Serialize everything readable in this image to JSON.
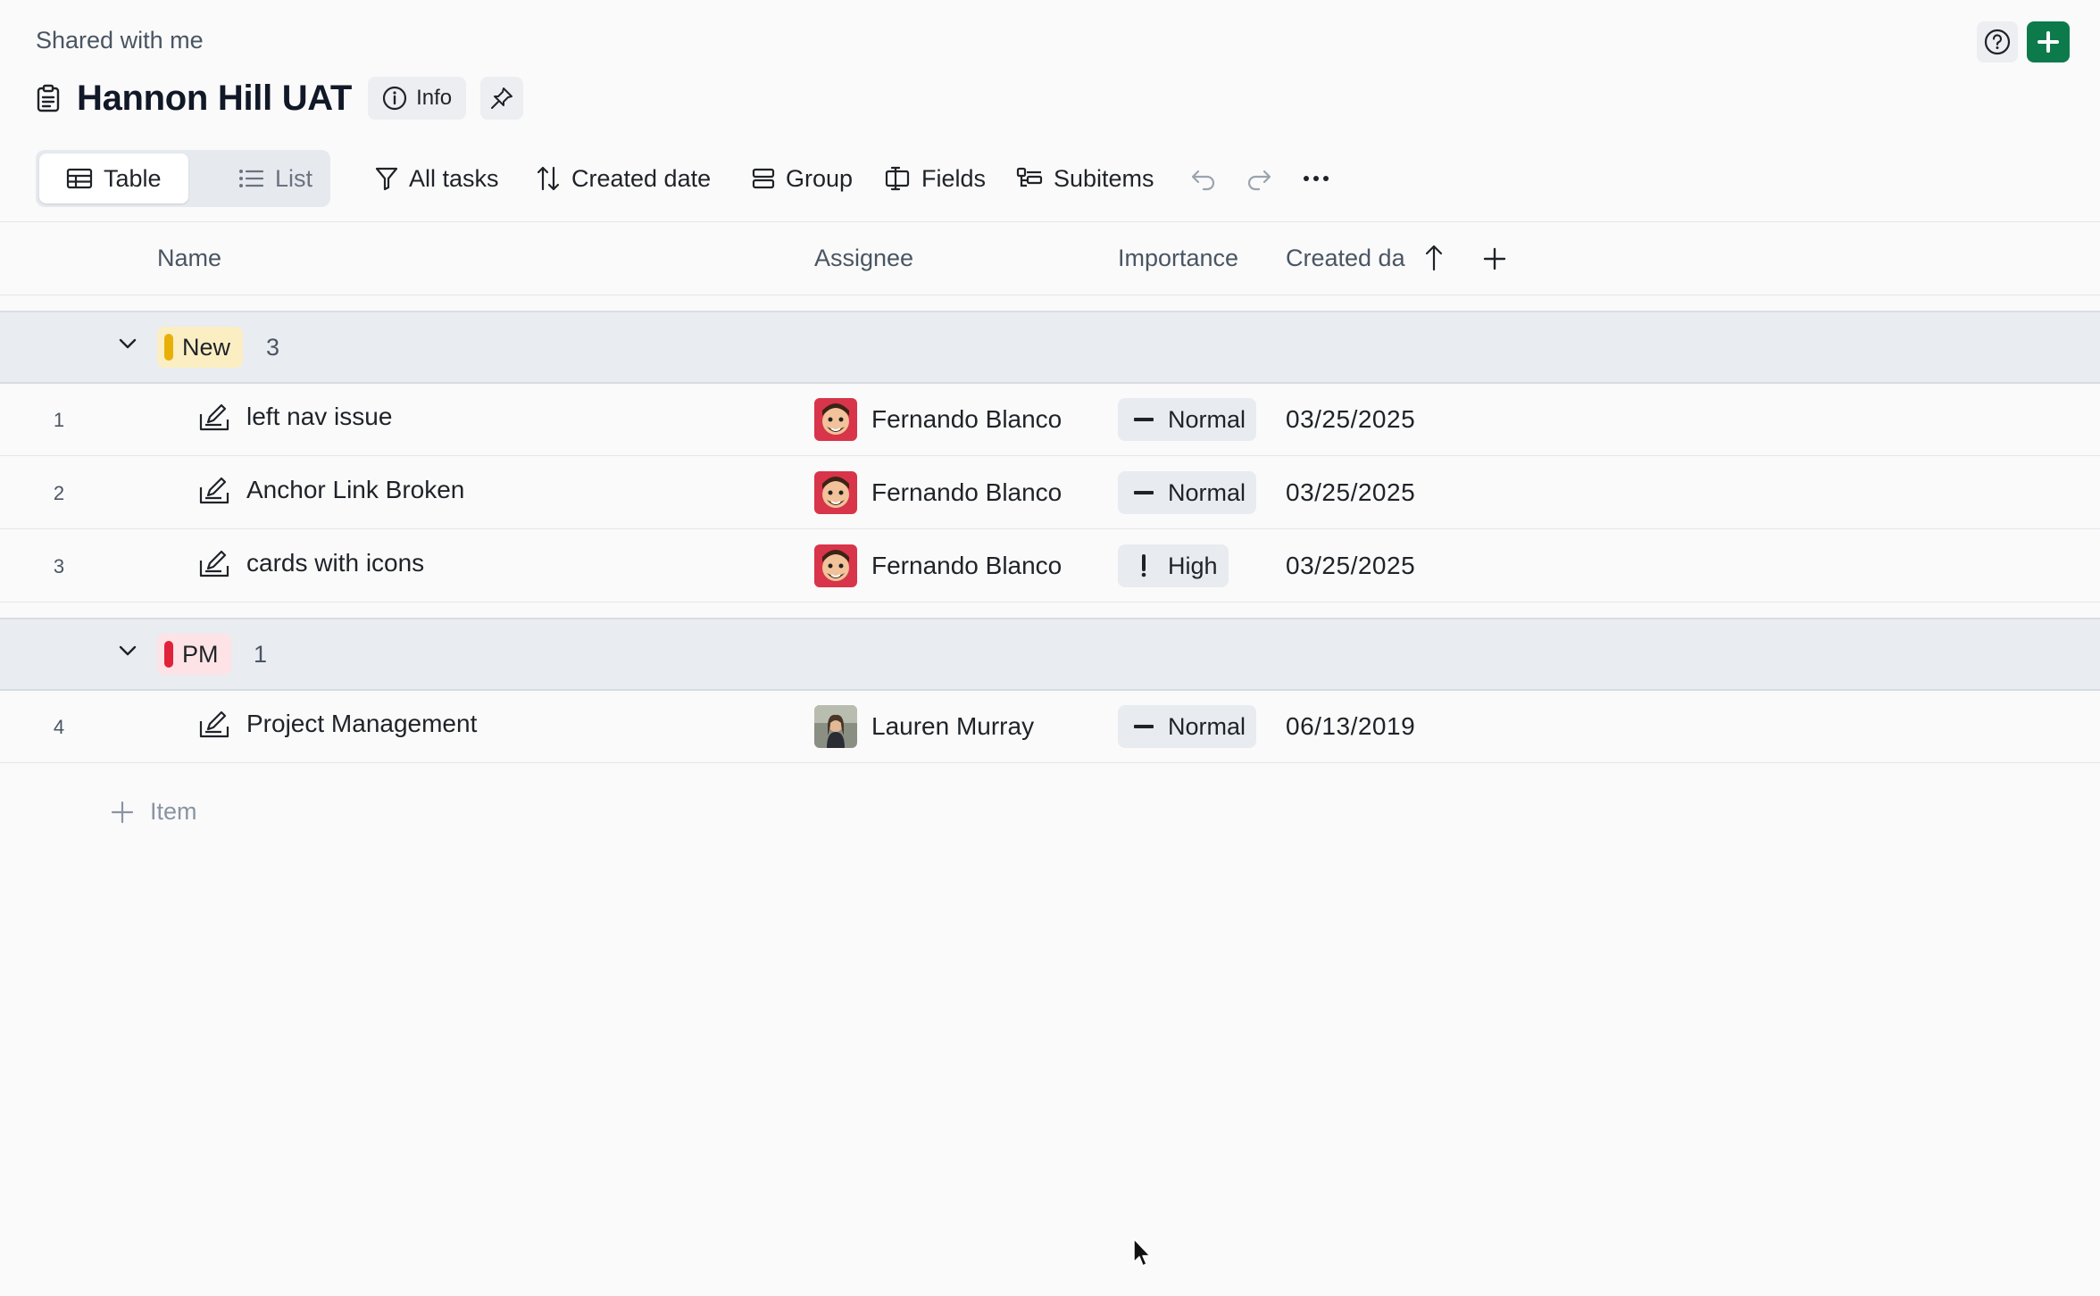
{
  "breadcrumb": "Shared with me",
  "title": "Hannon Hill UAT",
  "info_label": "Info",
  "views": {
    "table_label": "Table",
    "list_label": "List"
  },
  "toolbar": {
    "filter_label": "All tasks",
    "sort_label": "Created date",
    "group_label": "Group",
    "fields_label": "Fields",
    "subitems_label": "Subitems"
  },
  "columns": {
    "name": "Name",
    "assignee": "Assignee",
    "importance": "Importance",
    "created": "Created da"
  },
  "groups": [
    {
      "label": "New",
      "count": "3",
      "color": "#e8b007",
      "bg": "#fbeec3",
      "rows": [
        {
          "num": "1",
          "name": "left nav issue",
          "assignee": "Fernando Blanco",
          "importance": "Normal",
          "importance_icon": "dash-icon",
          "date": "03/25/2025"
        },
        {
          "num": "2",
          "name": "Anchor Link Broken",
          "assignee": "Fernando Blanco",
          "importance": "Normal",
          "importance_icon": "dash-icon",
          "date": "03/25/2025"
        },
        {
          "num": "3",
          "name": "cards with icons",
          "assignee": "Fernando Blanco",
          "importance": "High",
          "importance_icon": "exclamation-icon",
          "date": "03/25/2025"
        }
      ]
    },
    {
      "label": "PM",
      "count": "1",
      "color": "#e0223a",
      "bg": "#fde3e6",
      "rows": [
        {
          "num": "4",
          "name": "Project Management",
          "assignee": "Lauren Murray",
          "importance": "Normal",
          "importance_icon": "dash-icon",
          "date": "06/13/2019"
        }
      ]
    }
  ],
  "add_item_label": "Item",
  "colors": {
    "accent_green": "#0d7a4c",
    "group_bg": "#e9ecf0"
  }
}
